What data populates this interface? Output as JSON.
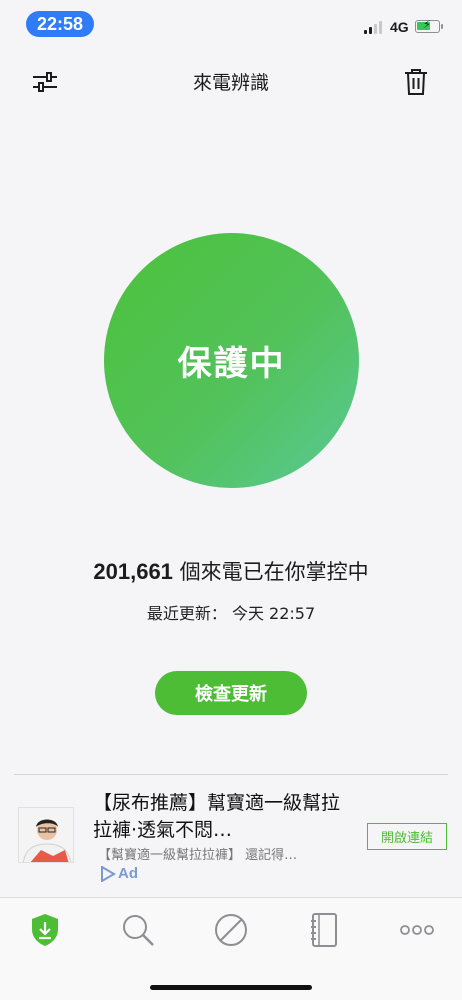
{
  "status_bar": {
    "time": "22:58",
    "network": "4G",
    "battery_level": 0.7
  },
  "nav": {
    "title": "來電辨識",
    "left_icon": "filter-settings-icon",
    "right_icon": "trash-icon"
  },
  "protection": {
    "status": "保護中"
  },
  "summary": {
    "count": "201,661",
    "text": " 個來電已在你掌控中"
  },
  "update": {
    "label": "最近更新：",
    "time": "今天 22:57",
    "button": "檢查更新"
  },
  "ad": {
    "title": "【尿布推薦】幫寶適一級幫拉拉褲·透氣不悶…",
    "description": "【幫寶適一級幫拉拉褲】 還記得…",
    "badge": "Ad",
    "cta": "開啟連結"
  },
  "tabs": [
    {
      "icon": "shield-download-icon",
      "active": true
    },
    {
      "icon": "search-icon",
      "active": false
    },
    {
      "icon": "block-icon",
      "active": false
    },
    {
      "icon": "notebook-icon",
      "active": false
    },
    {
      "icon": "more-icon",
      "active": false
    }
  ],
  "colors": {
    "accent": "#4cbd34",
    "time_pill": "#2f7cf6"
  }
}
